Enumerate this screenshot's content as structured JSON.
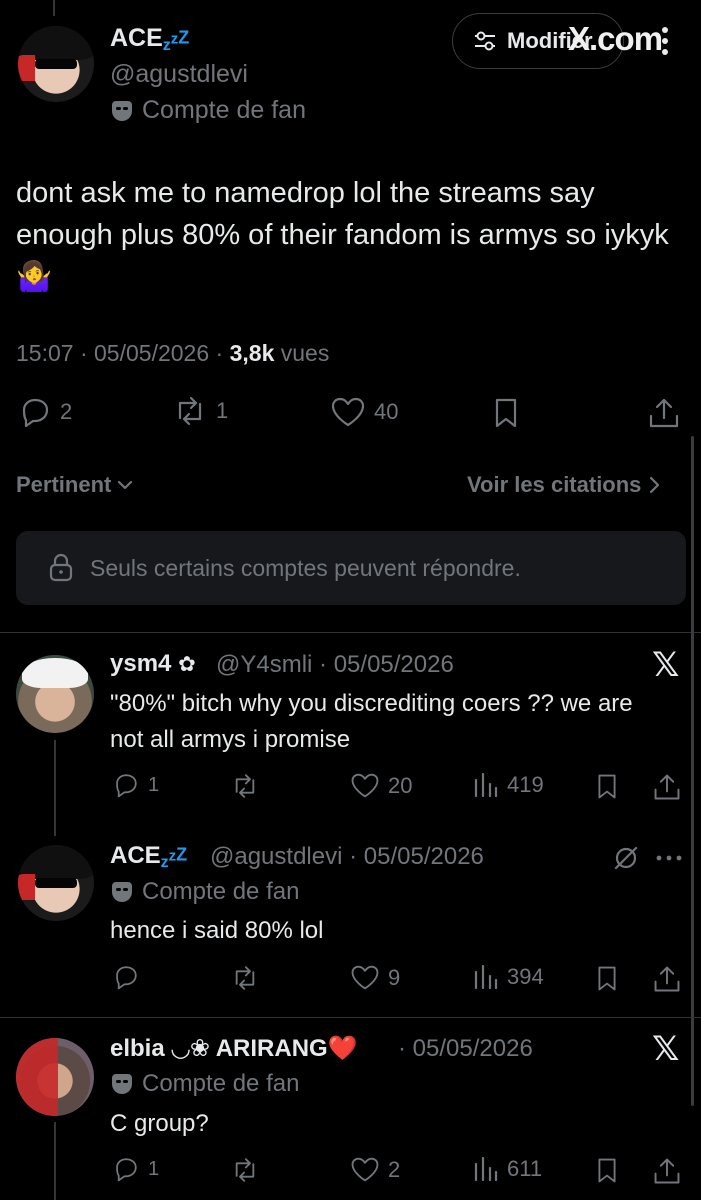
{
  "top_bar": {
    "modifier_label": "Modifier",
    "watermark": "X.com"
  },
  "main_tweet": {
    "name": "ACE",
    "name_badge": "zzZ",
    "handle": "@agustdlevi",
    "fan_label": "Compte de fan",
    "text": "dont ask me to namedrop lol the streams say enough plus 80% of their fandom is armys so iykyk🤷‍♀️",
    "time": "15:07",
    "date": "05/05/2026",
    "views_count": "3,8k",
    "views_label": "vues",
    "replies": "2",
    "reposts": "1",
    "likes": "40"
  },
  "sort": {
    "label": "Pertinent",
    "quotes_label": "Voir les citations"
  },
  "restriction": {
    "text": "Seuls certains comptes peuvent répondre."
  },
  "replies": [
    {
      "name": "ysm4",
      "name_badge": "✿",
      "handle": "@Y4smli",
      "date": "05/05/2026",
      "text": "\"80%\" bitch why you discrediting coers ?? we are not all armys i promise",
      "replies": "1",
      "likes": "20",
      "views": "419"
    },
    {
      "name": "ACE",
      "name_badge": "zzZ",
      "handle": "@agustdlevi",
      "date": "05/05/2026",
      "fan_label": "Compte de fan",
      "text": "hence i said 80% lol",
      "likes": "9",
      "views": "394"
    },
    {
      "name": "elbia",
      "name_badge": "◡❀ ARIRANG❤️",
      "date": "05/05/2026",
      "fan_label": "Compte de fan",
      "text": "C group?",
      "replies": "1",
      "likes": "2",
      "views": "611"
    }
  ]
}
